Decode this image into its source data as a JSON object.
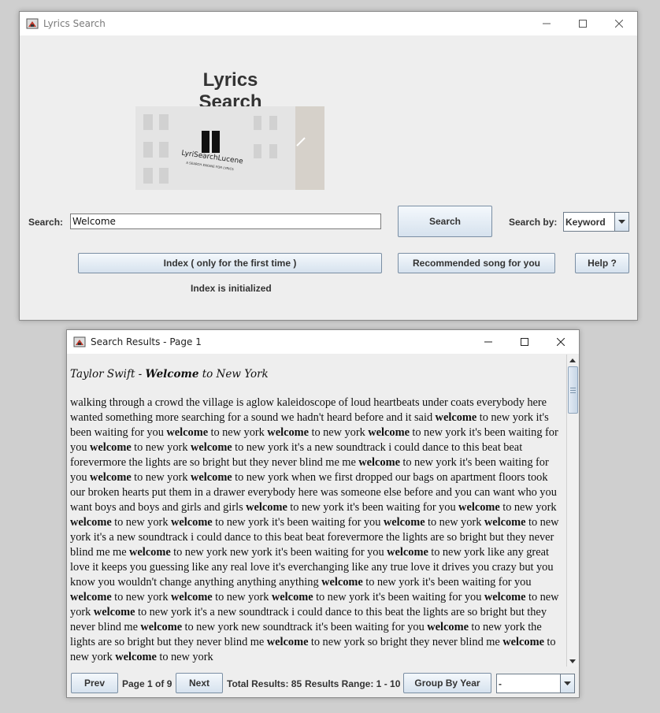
{
  "main_window": {
    "title": "Lyrics Search",
    "heading": "Lyrics Search",
    "logo": {
      "text": "LyriSearchLucene",
      "tagline": "A SEARCH ENGINE FOR LYRICS"
    },
    "search_label": "Search:",
    "search_value": "Welcome",
    "search_button": "Search",
    "search_by_label": "Search by:",
    "search_by_value": "Keyword",
    "index_button": "Index ( only for the first time )",
    "recommended_button": "Recommended song for you",
    "help_button": "Help ?",
    "index_status": "Index is initialized"
  },
  "results_window": {
    "title": "Search Results - Page 1",
    "result": {
      "artist": "Taylor Swift",
      "separator": " - ",
      "title_highlight": "Welcome",
      "title_rest": " to New York",
      "highlight_word": "welcome",
      "lyrics": "walking through a crowd the village is aglow kaleidoscope of loud heartbeats under coats everybody here wanted something more searching for a sound we hadn't heard before and it said welcome to new york it's been waiting for you welcome to new york welcome to new york welcome to new york it's been waiting for you welcome to new york welcome to new york it's a new soundtrack i could dance to this beat beat forevermore the lights are so bright but they never blind me me welcome to new york it's been waiting for you welcome to new york welcome to new york when we first dropped our bags on apartment floors took our broken hearts put them in a drawer everybody here was someone else before and you can want who you want boys and boys and girls and girls welcome to new york it's been waiting for you welcome to new york welcome to new york welcome to new york it's been waiting for you welcome to new york welcome to new york it's a new soundtrack i could dance to this beat beat forevermore the lights are so bright but they never blind me me welcome to new york new york it's been waiting for you welcome to new york like any great love it keeps you guessing like any real love it's everchanging like any true love it drives you crazy but you know you wouldn't change anything anything anything welcome to new york it's been waiting for you welcome to new york welcome to new york welcome to new york it's been waiting for you welcome to new york welcome to new york it's a new soundtrack i could dance to this beat the lights are so bright but they never blind me welcome to new york new soundtrack it's been waiting for you welcome to new york the lights are so bright but they never blind me welcome to new york so bright they never blind me welcome to new york welcome to new york"
    },
    "prev_button": "Prev",
    "page_info_prefix": "Page ",
    "page_current": "1",
    "page_info_mid": " of ",
    "page_total": "9",
    "next_button": "Next",
    "total_results": "Total Results: 85",
    "results_range": "Results Range: 1 - 10",
    "group_button": "Group By Year",
    "group_select_value": "-"
  }
}
